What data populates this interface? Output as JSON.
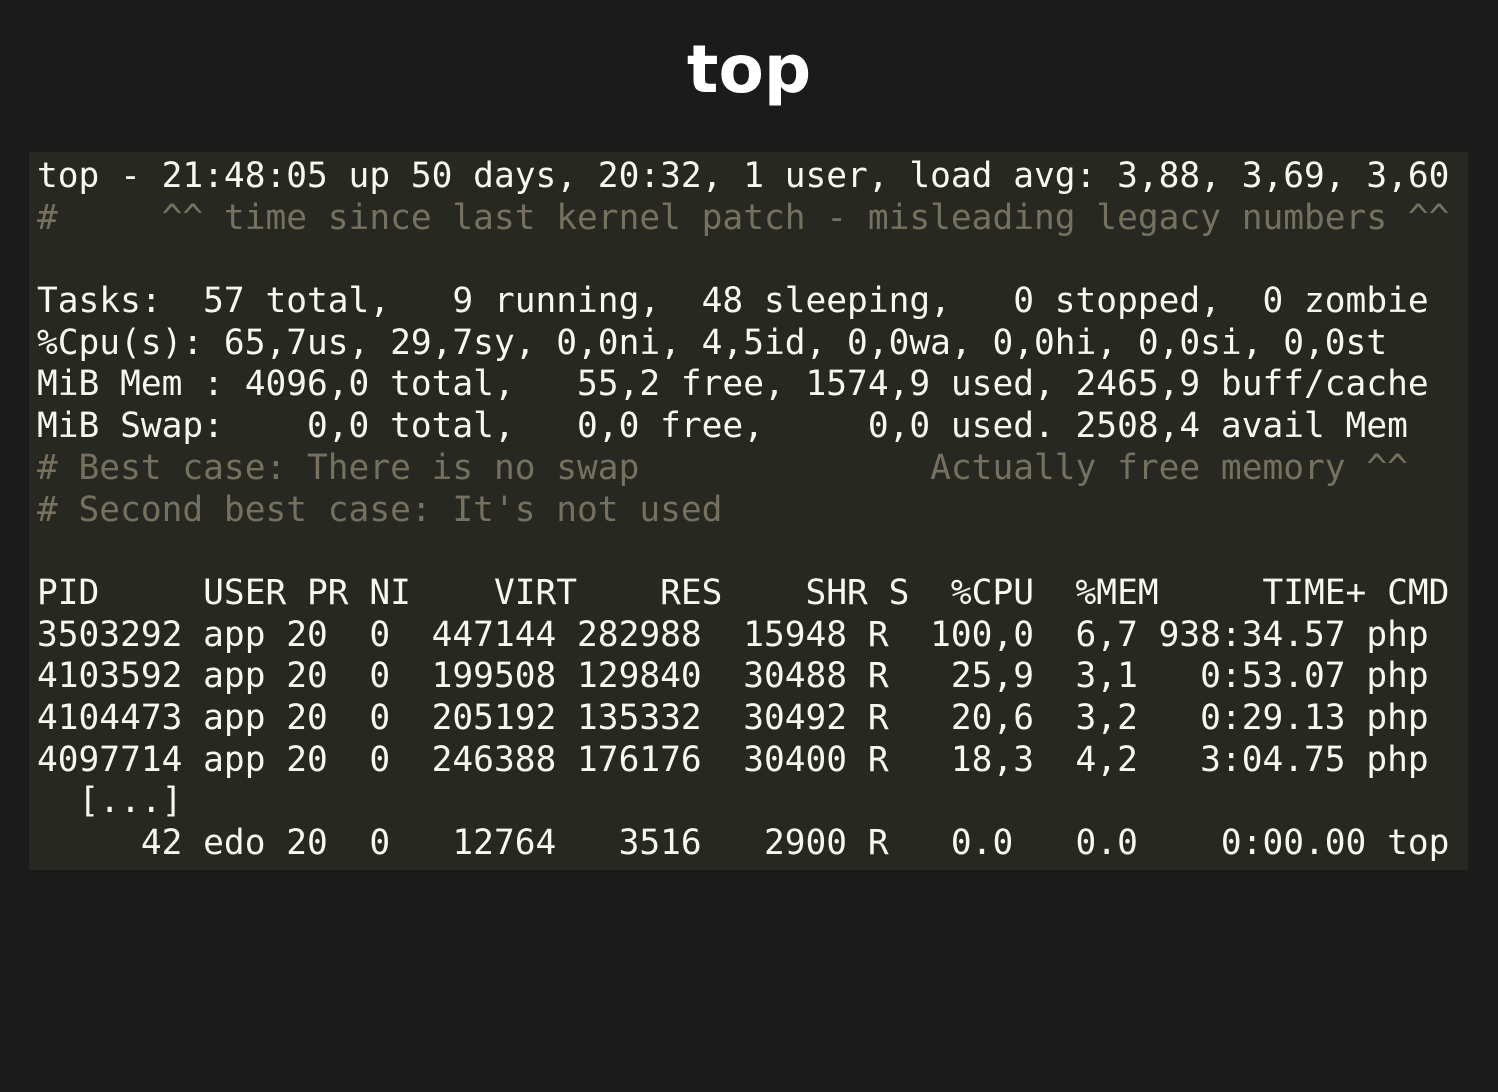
{
  "title": "top",
  "terminal": {
    "uptime": "top - 21:48:05 up 50 days, 20:32, 1 user, load avg: 3,88, 3,69, 3,60",
    "uptime_comment": "#     ^^ time since last kernel patch - misleading legacy numbers ^^",
    "tasks": "Tasks:  57 total,   9 running,  48 sleeping,   0 stopped,  0 zombie",
    "cpu": "%Cpu(s): 65,7us, 29,7sy, 0,0ni, 4,5id, 0,0wa, 0,0hi, 0,0si, 0,0st",
    "mem": "MiB Mem : 4096,0 total,   55,2 free, 1574,9 used, 2465,9 buff/cache",
    "swap": "MiB Swap:    0,0 total,   0,0 free,     0,0 used. 2508,4 avail Mem",
    "swap_comment_1": "# Best case: There is no swap              Actually free memory ^^",
    "swap_comment_2": "# Second best case: It's not used",
    "process_header": "PID     USER PR NI    VIRT    RES    SHR S  %CPU  %MEM     TIME+ CMD",
    "processes": [
      "3503292 app 20  0  447144 282988  15948 R  100,0  6,7 938:34.57 php",
      "4103592 app 20  0  199508 129840  30488 R   25,9  3,1   0:53.07 php",
      "4104473 app 20  0  205192 135332  30492 R   20,6  3,2   0:29.13 php",
      "4097714 app 20  0  246388 176176  30400 R   18,3  4,2   3:04.75 php"
    ],
    "ellipsis": "  [...]",
    "last_process": "     42 edo 20  0   12764   3516   2900 R   0.0   0.0    0:00.00 top"
  }
}
